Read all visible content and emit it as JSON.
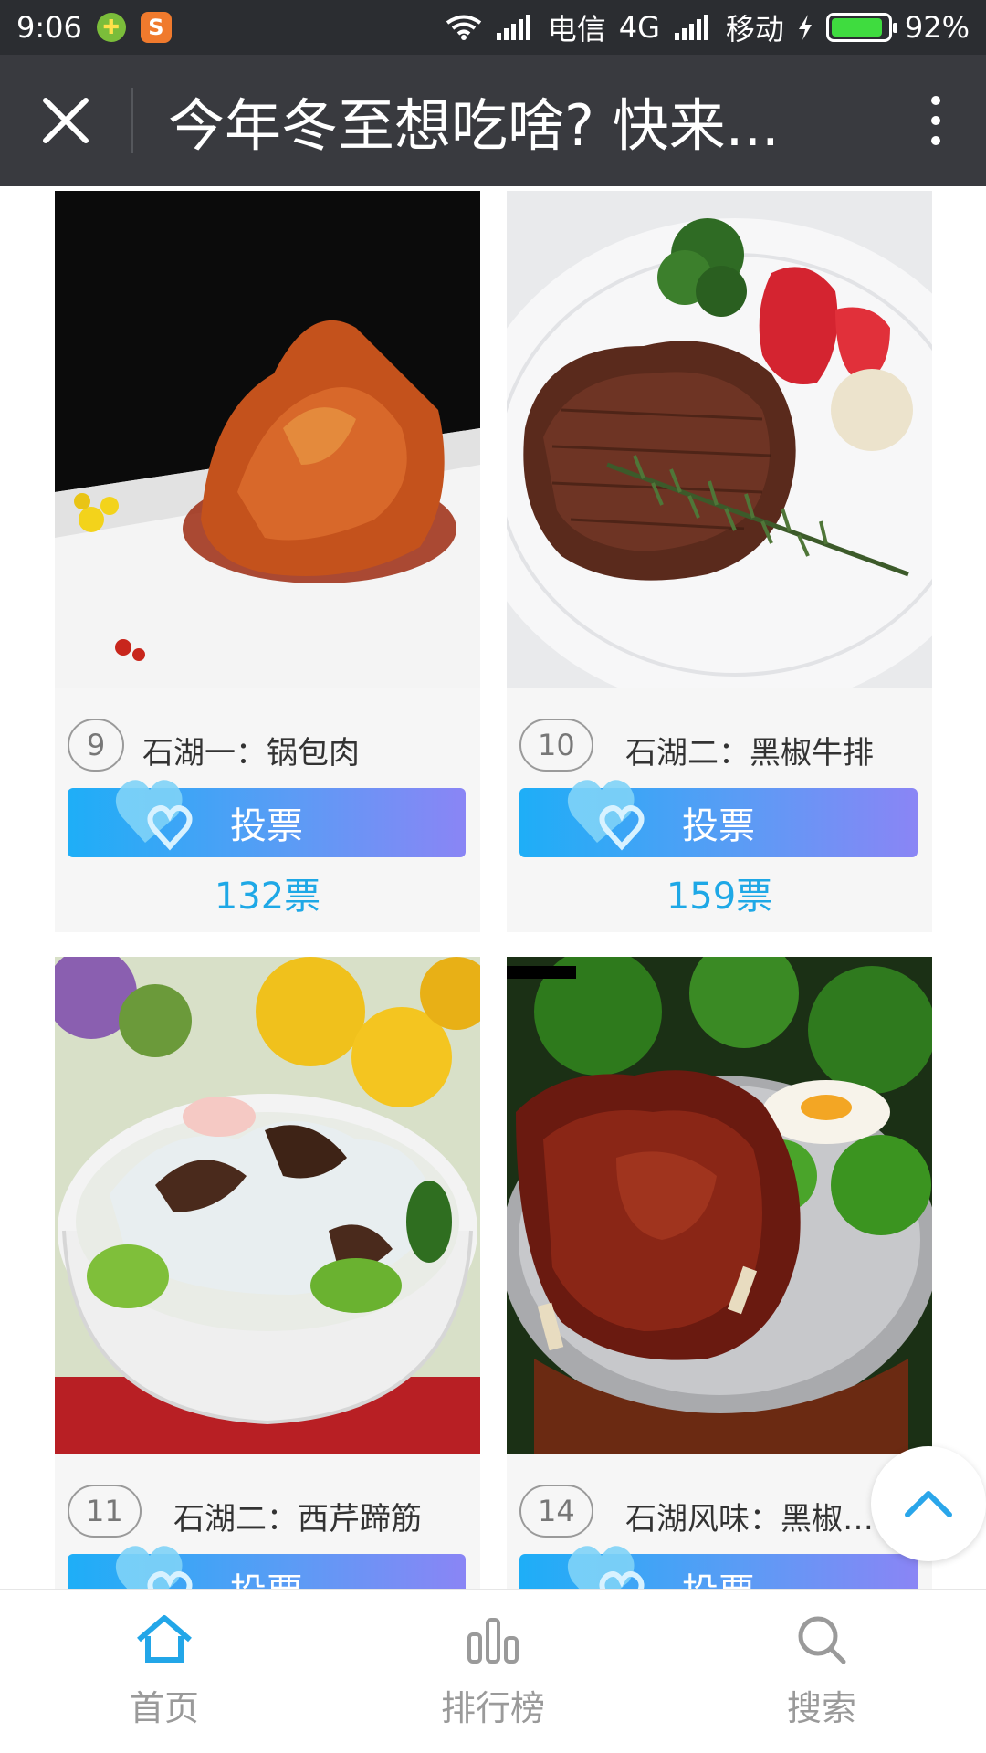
{
  "status_bar": {
    "time": "9:06",
    "carrier1": "电信",
    "network": "4G",
    "carrier2": "移动",
    "battery": "92%",
    "battery_level": 0.92
  },
  "title_bar": {
    "title": "今年冬至想吃啥? 快来..."
  },
  "cards": [
    {
      "number": "9",
      "name": "石湖一：锅包肉",
      "vote_label": "投票",
      "votes": "132票"
    },
    {
      "number": "10",
      "name": "石湖二：黑椒牛排",
      "vote_label": "投票",
      "votes": "159票"
    },
    {
      "number": "11",
      "name": "石湖二：西芹蹄筋",
      "vote_label": "投票",
      "votes": ""
    },
    {
      "number": "14",
      "name": "石湖风味：黑椒牛…",
      "vote_label": "投票",
      "votes": ""
    }
  ],
  "bottom_nav": {
    "items": [
      {
        "label": "首页",
        "icon": "home-icon"
      },
      {
        "label": "排行榜",
        "icon": "bar-chart-icon"
      },
      {
        "label": "搜索",
        "icon": "search-icon"
      }
    ]
  },
  "colors": {
    "accent": "#1ea8e6",
    "title_bar_bg": "#393a3f",
    "status_bar_bg": "#2b2d31",
    "vote_gradient_start": "#1eaef7",
    "vote_gradient_end": "#8a85f5",
    "home_icon": "#22a6e8"
  }
}
